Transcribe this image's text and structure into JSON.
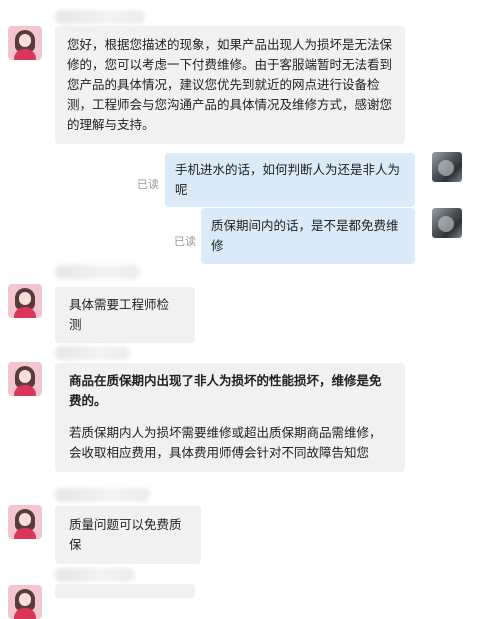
{
  "messages": {
    "m1": "您好，根据您描述的现象，如果产品出现人为损坏是无法保修的，您可以考虑一下付费维修。由于客服端暂时无法看到您产品的具体情况，建议您优先到就近的网点进行设备检测，工程师会与您沟通产品的具体情况及维修方式，感谢您的理解与支持。",
    "m2": "手机进水的话，如何判断人为还是非人为呢",
    "m3": "质保期间内的话，是不是都免费维修",
    "m4": "具体需要工程师检测",
    "m5_bold": "商品在质保期内出现了非人为损坏的性能损坏，维修是免费的。",
    "m5_body": "若质保期内人为损坏需要维修或超出质保期商品需维修，会收取相应费用，具体费用师傅会针对不同故障告知您",
    "m6": "质量问题可以免费质保"
  },
  "status": {
    "read_label": "已读"
  }
}
